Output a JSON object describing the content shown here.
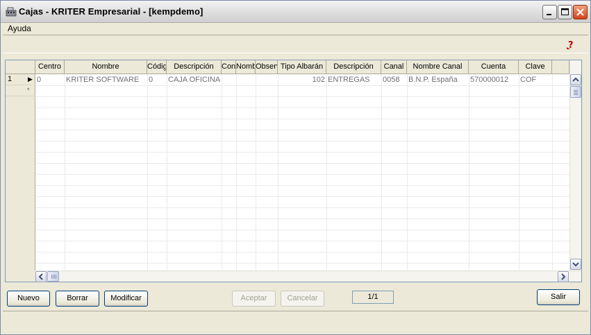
{
  "window": {
    "title": "Cajas - KRITER Empresarial - [kempdemo]"
  },
  "menu": {
    "items": [
      "Ayuda"
    ]
  },
  "grid": {
    "columns": [
      "Centro",
      "Nombre",
      "Código",
      "Descripción",
      "Cons",
      "Nombre",
      "Observación",
      "Tipo Albarán",
      "Descripción",
      "Canal",
      "Nombre Canal",
      "Cuenta",
      "Clave"
    ],
    "rows": [
      {
        "index": "1",
        "cells": [
          "0",
          "KRITER SOFTWARE",
          "0",
          "CAJA OFICINA",
          "",
          "",
          "",
          "102",
          "ENTREGAS",
          "0058",
          "B.N.P. España",
          "570000012",
          "COF"
        ]
      }
    ],
    "new_row_marker": "*"
  },
  "buttons": {
    "nuevo": "Nuevo",
    "borrar": "Borrar",
    "modificar": "Modificar",
    "aceptar": "Aceptar",
    "cancelar": "Cancelar",
    "salir": "Salir"
  },
  "pager": "1/1",
  "icons": {
    "app": "cash-register-icon",
    "help": "help-question-icon"
  },
  "colors": {
    "window_bg": "#ece9d8",
    "grid_border": "#7f9db9",
    "close_button": "#d2441c"
  }
}
